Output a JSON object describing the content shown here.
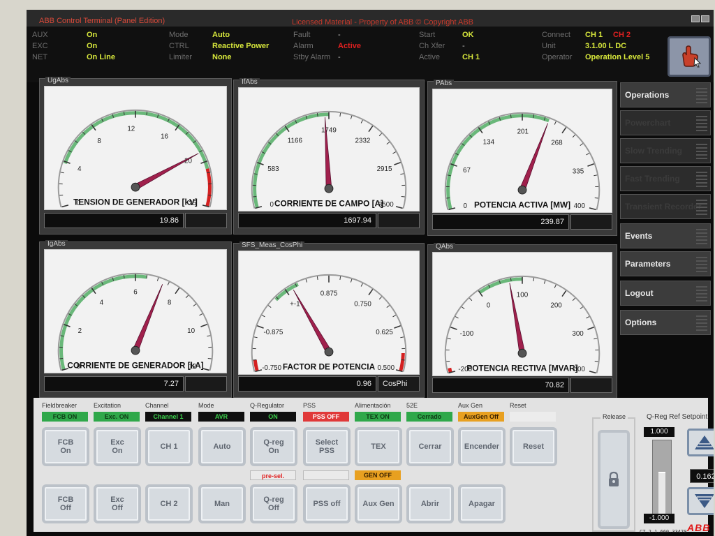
{
  "app": {
    "title": "ABB Control Terminal (Panel Edition)",
    "license": "Licensed Material - Property of ABB © Copyright ABB",
    "brand": "ABB"
  },
  "status": {
    "col1": [
      {
        "label": "AUX",
        "value": "On"
      },
      {
        "label": "EXC",
        "value": "On"
      },
      {
        "label": "NET",
        "value": "On Line"
      }
    ],
    "col2": [
      {
        "label": "Mode",
        "value": "Auto"
      },
      {
        "label": "CTRL",
        "value": "Reactive Power"
      },
      {
        "label": "Limiter",
        "value": "None"
      }
    ],
    "col3": [
      {
        "label": "Fault",
        "value": "-"
      },
      {
        "label": "Alarm",
        "value": "Active"
      },
      {
        "label": "Stby Alarm",
        "value": "-"
      }
    ],
    "col4": [
      {
        "label": "Start",
        "value": "OK"
      },
      {
        "label": "Ch Xfer",
        "value": "-"
      },
      {
        "label": "Active",
        "value": "CH 1"
      }
    ],
    "col5": [
      {
        "label": "Connect",
        "value": "CH 1",
        "value2": "CH 2"
      },
      {
        "label": "Unit",
        "value": "3.1.00  L  DC"
      },
      {
        "label": "Operator",
        "value": "Operation Level 5"
      }
    ]
  },
  "gauges": [
    {
      "tag": "UgAbs",
      "title": "TENSION DE GENERADOR [kV]",
      "readout": "19.86",
      "unit": "",
      "min": 0,
      "max": 25,
      "value": 19.86,
      "ticks": [
        "0",
        "4",
        "8",
        "12",
        "16",
        "20",
        "25"
      ],
      "tick_values": [
        0,
        4,
        8,
        12,
        16,
        20,
        25
      ],
      "green_from": 4,
      "green_to": 21.5,
      "red_from": 21.5,
      "red_to": 25
    },
    {
      "tag": "IfAbs",
      "title": "CORRIENTE DE CAMPO [A]",
      "readout": "1697.94",
      "unit": "",
      "min": 0,
      "max": 3500,
      "value": 1697.94,
      "ticks": [
        "0",
        "583",
        "1166",
        "1749",
        "2332",
        "2915",
        "3500"
      ],
      "tick_values": [
        0,
        583,
        1166,
        1749,
        2332,
        2915,
        3500
      ],
      "green_from": 0,
      "green_to": 1749,
      "red_from": null,
      "red_to": null
    },
    {
      "tag": "PAbs",
      "title": "POTENCIA ACTIVA [MW]",
      "readout": "239.87",
      "unit": "",
      "min": 0,
      "max": 400,
      "value": 239.87,
      "ticks": [
        "0",
        "67",
        "134",
        "201",
        "268",
        "335",
        "400"
      ],
      "tick_values": [
        0,
        67,
        134,
        201,
        268,
        335,
        400
      ],
      "green_from": 0,
      "green_to": 240,
      "red_from": null,
      "red_to": null
    },
    {
      "tag": "IgAbs",
      "title": "CORRIENTE DE GENERADOR [kA]",
      "readout": "7.27",
      "unit": "",
      "min": 0,
      "max": 12,
      "value": 7.27,
      "ticks": [
        "0",
        "2",
        "4",
        "6",
        "8",
        "10",
        "12"
      ],
      "tick_values": [
        0,
        2,
        4,
        6,
        8,
        10,
        12
      ],
      "green_from": 0,
      "green_to": 6.5,
      "red_from": null,
      "red_to": null
    },
    {
      "tag": "SFS_Meas_CosPhi",
      "title": "FACTOR DE POTENCIA",
      "readout": "0.96",
      "unit": "CosPhi",
      "min": 0,
      "max": 6,
      "value": 2.15,
      "ticks": [
        "-0.750",
        "-0.875",
        "+-1",
        "0.875",
        "0.750",
        "0.625",
        "0.500"
      ],
      "tick_values": [
        0,
        1,
        2,
        3,
        4,
        5,
        6
      ],
      "green_from": 1.7,
      "green_to": 2.3,
      "red_from": 5.6,
      "red_to": 6,
      "red2_from": 0,
      "red2_to": 0.25
    },
    {
      "tag": "QAbs",
      "title": "POTENCIA RECTIVA [MVAR]",
      "readout": "70.82",
      "unit": "",
      "min": -200,
      "max": 400,
      "value": 70.82,
      "ticks": [
        "-200",
        "-100",
        "0",
        "100",
        "200",
        "300",
        "400"
      ],
      "tick_values": [
        -200,
        -100,
        0,
        100,
        200,
        300,
        400
      ],
      "green_from": 0,
      "green_to": 100,
      "red_from": null,
      "red_to": null,
      "red2_from": -200,
      "red2_to": -190
    }
  ],
  "nav": [
    {
      "label": "Operations",
      "active": true
    },
    {
      "label": "Powerchart",
      "active": false
    },
    {
      "label": "Slow Trending",
      "active": false
    },
    {
      "label": "Fast Trending",
      "active": false
    },
    {
      "label": "Transient Recorder",
      "active": false
    },
    {
      "label": "Events",
      "active": true
    },
    {
      "label": "Parameters",
      "active": true
    },
    {
      "label": "Logout",
      "active": true
    },
    {
      "label": "Options",
      "active": true
    }
  ],
  "controls": {
    "groups": [
      {
        "label": "Fieldbreaker",
        "indicator": "FCB ON",
        "ind_color": "#2fa84a",
        "ind_text": "#0d3a14",
        "top": "FCB\nOn",
        "bottom": "FCB\nOff"
      },
      {
        "label": "Excitation",
        "indicator": "Exc. ON",
        "ind_color": "#2fa84a",
        "ind_text": "#0d3a14",
        "top": "Exc\nOn",
        "bottom": "Exc\nOff"
      },
      {
        "label": "Channel",
        "indicator": "Channel 1",
        "ind_color": "#0f0f0f",
        "ind_text": "#3cd04c",
        "top": "CH 1",
        "bottom": "CH 2"
      },
      {
        "label": "Mode",
        "indicator": "AVR",
        "ind_color": "#0f0f0f",
        "ind_text": "#3cd04c",
        "top": "Auto",
        "bottom": "Man"
      },
      {
        "label": "Q-Regulator",
        "indicator": "ON",
        "ind_color": "#0f0f0f",
        "ind_text": "#3cd04c",
        "top": "Q-reg\nOn",
        "bottom": "Q-reg\nOff",
        "mid": "pre-sel."
      },
      {
        "label": "PSS",
        "indicator": "PSS OFF",
        "ind_color": "#e03838",
        "ind_text": "#ffffff",
        "top": "Select\nPSS",
        "bottom": "PSS off"
      },
      {
        "label": "Alimentación",
        "indicator": "TEX ON",
        "ind_color": "#2fa84a",
        "ind_text": "#0d3a14",
        "top": "TEX",
        "bottom": "Aux Gen",
        "mid": "GEN OFF"
      },
      {
        "label": "52E",
        "indicator": "Cerrado",
        "ind_color": "#2fa84a",
        "ind_text": "#0d3a14",
        "top": "Cerrar",
        "bottom": "Abrir"
      },
      {
        "label": "Aux Gen",
        "indicator": "AuxGen Off",
        "ind_color": "#e8a020",
        "ind_text": "#3a2200",
        "top": "Encender",
        "bottom": "Apagar"
      },
      {
        "label": "Reset",
        "indicator": "",
        "ind_color": "#ececec",
        "ind_text": "#333",
        "top": "Reset",
        "bottom": ""
      }
    ],
    "release_label": "Release",
    "qreg": {
      "label": "Q-Reg Ref Setpoint",
      "max": "1.000",
      "min": "-1.000",
      "value": "0.162",
      "fraction": 0.58
    },
    "version": "CT 2.1.660.33470"
  }
}
